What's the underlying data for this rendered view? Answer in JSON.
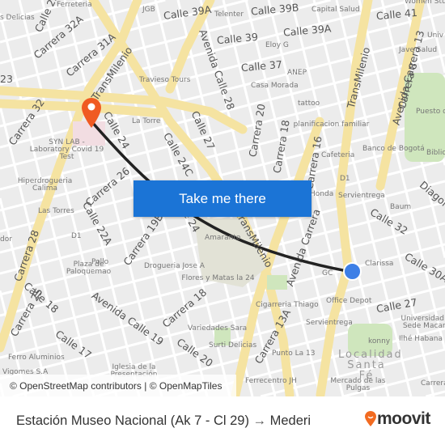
{
  "map": {
    "labels": [
      "Ferreteria",
      "JGB",
      "Calle 39A",
      "Telenter",
      "Calle 39B",
      "Capital Salud",
      "Calle 41",
      "Women Stu",
      "s Delicias",
      "Calle 25B",
      "Carrera 32A",
      "Carrera 31A",
      "TransMilenio",
      "Avenida Calle 28",
      "Calle 39",
      "Eloy G",
      "Calle 39A",
      "Univ",
      "Jave Salud",
      "Calle 37",
      "ANEP",
      "Travieso Tours",
      "Casa Morada",
      "23",
      "TransMilenio",
      "Avenida Carrera 13",
      "Carrera 8",
      "Carrera 32",
      "Calle 24",
      "La Torre",
      "Calle 27",
      "Carrera 20",
      "Carrera 18",
      "tattoo",
      "planificacion familiar",
      "Puesto de",
      "SYN LAB - Laboratory Covid 19 Test",
      "Calle 24C",
      "Carrera 16",
      "Cafeteria",
      "Banco de Bogotá",
      "Biblio Parqu",
      "Hiperdrogueria Calima",
      "Carrera 26",
      "D1",
      "Honda",
      "Servientrega",
      "Diagon",
      "Las Torres",
      "Calle 22A",
      "Carrera 19B",
      "Calle 24",
      "Amaranto",
      "TransMilenio",
      "Avenida Carrera",
      "Baum",
      "Calle 32",
      "D1",
      "Carrera 28",
      "dor",
      "Plaza de Paloquemao",
      "Pollo",
      "Drogueria Jose A",
      "Flores y Matas la 24",
      "GC",
      "Clarissa",
      "Calle 30A",
      "Calle 18",
      "Carrera 25",
      "Avenida Calle 19",
      "Carrera 18",
      "Cigarreria Thiago",
      "Office Depot",
      "Calle 27",
      "Variedades Sara",
      "Servientrega",
      "Universidad Dist Sede Macarena",
      "Calle 17",
      "Surti Delicias",
      "Carrera 13A",
      "Ilhé Habana",
      "konny",
      "Ferro Aluminios",
      "Calle 20",
      "Punto La 13",
      "Localidad Santa Fé",
      "Iglesia de la Presentación",
      "Vigomes S.A",
      "Ferrecentro JH",
      "Mercado de las Pulgas",
      "Carrera 2"
    ],
    "route_color": "#222222",
    "origin_marker_color": "#3d7fe6",
    "destination_marker_color": "#f05a22",
    "destination_icon": "map-pin-icon",
    "origin_icon": "location-dot-icon"
  },
  "attribution": "© OpenStreetMap contributors | © OpenMapTiles",
  "cta": {
    "label": "Take me there"
  },
  "footer": {
    "origin": "Estación Museo Nacional (Ak 7 - Cl 29)",
    "arrow": "→",
    "destination": "Mederi",
    "logo_text": "moovit",
    "brand_color": "#f26b21"
  }
}
